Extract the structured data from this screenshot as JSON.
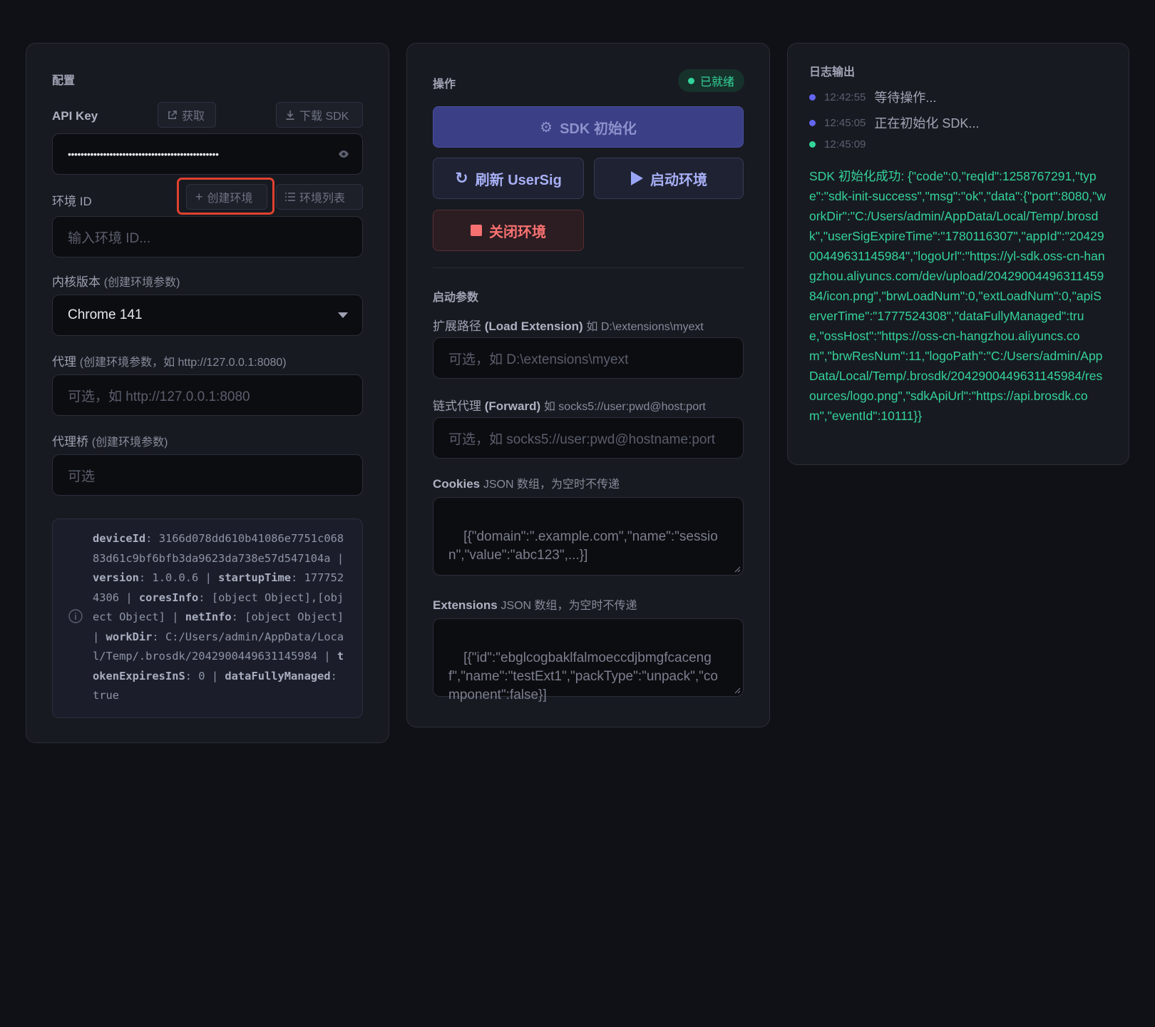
{
  "config": {
    "title": "配置",
    "api_key_label": "API Key",
    "get_button": "获取",
    "download_sdk_button": "下载 SDK",
    "api_key_value": "•••••••••••••••••••••••••••••••••••••••••••••••",
    "env_id_label": "环境 ID",
    "create_env_button": "创建环境",
    "env_list_button": "环境列表",
    "env_id_placeholder": "输入环境 ID...",
    "kernel_label": "内核版本",
    "kernel_note": "(创建环境参数)",
    "kernel_value": "Chrome 141",
    "proxy_label": "代理",
    "proxy_note": "(创建环境参数，如 http://127.0.0.1:8080)",
    "proxy_placeholder": "可选，如 http://127.0.0.1:8080",
    "bridge_label": "代理桥",
    "bridge_note": "(创建环境参数)",
    "bridge_placeholder": "可选",
    "info": {
      "deviceId_key": "deviceId",
      "deviceId": "3166d078dd610b41086e7751c06883d61c9bf6bfb3da9623da738e57d547104a",
      "version_key": "version",
      "version": "1.0.0.6",
      "startupTime_key": "startupTime",
      "startupTime": "1777524306",
      "coresInfo_key": "coresInfo",
      "coresInfo": "[object Object],[object Object]",
      "netInfo_key": "netInfo",
      "netInfo": "[object Object]",
      "workDir_key": "workDir",
      "workDir": "C:/Users/admin/AppData/Local/Temp/.brosdk/2042900449631145984",
      "tokenExpiresInS_key": "tokenExpiresInS",
      "tokenExpiresInS": "0",
      "dataFullyManaged_key": "dataFullyManaged",
      "dataFullyManaged": "true"
    }
  },
  "ops": {
    "title": "操作",
    "status_badge": "已就绪",
    "sdk_init_button": "SDK 初始化",
    "refresh_usersig_button": "刷新 UserSig",
    "start_env_button": "启动环境",
    "close_env_button": "关闭环境",
    "launch_params_title": "启动参数",
    "ext_path_label_a": "扩展路径",
    "ext_path_label_b": "(Load Extension)",
    "ext_path_label_c": "如 D:\\extensions\\myext",
    "ext_path_placeholder": "可选，如 D:\\extensions\\myext",
    "chain_proxy_label_a": "链式代理",
    "chain_proxy_label_b": "(Forward)",
    "chain_proxy_label_c": "如 socks5://user:pwd@host:port",
    "chain_proxy_placeholder": "可选，如 socks5://user:pwd@hostname:port",
    "cookies_label_a": "Cookies",
    "cookies_label_b": "JSON 数组，为空时不传递",
    "cookies_placeholder": "[{\"domain\":\".example.com\",\"name\":\"session\",\"value\":\"abc123\",...}]",
    "extensions_label_a": "Extensions",
    "extensions_label_b": "JSON 数组，为空时不传递",
    "extensions_placeholder": "[{\"id\":\"ebglcogbaklfalmoeccdjbmgfcacengf\",\"name\":\"testExt1\",\"packType\":\"unpack\",\"component\":false}]"
  },
  "log": {
    "title": "日志输出",
    "entries": [
      {
        "time": "12:42:55",
        "message": "等待操作..."
      },
      {
        "time": "12:45:05",
        "message": "正在初始化 SDK..."
      },
      {
        "time": "12:45:09",
        "message": ""
      }
    ],
    "success_text": "SDK 初始化成功: {\"code\":0,\"reqId\":1258767291,\"type\":\"sdk-init-success\",\"msg\":\"ok\",\"data\":{\"port\":8080,\"workDir\":\"C:/Users/admin/AppData/Local/Temp/.brosdk\",\"userSigExpireTime\":\"1780116307\",\"appId\":\"2042900449631145984\",\"logoUrl\":\"https://yl-sdk.oss-cn-hangzhou.aliyuncs.com/dev/upload/2042900449631145984/icon.png\",\"brwLoadNum\":0,\"extLoadNum\":0,\"apiServerTime\":\"1777524308\",\"dataFullyManaged\":true,\"ossHost\":\"https://oss-cn-hangzhou.aliyuncs.com\",\"brwResNum\":11,\"logoPath\":\"C:/Users/admin/AppData/Local/Temp/.brosdk/2042900449631145984/resources/logo.png\",\"sdkApiUrl\":\"https://api.brosdk.com\",\"eventId\":10111}}"
  },
  "colors": {
    "accent": "#5b62d6",
    "success": "#34d399",
    "danger": "#f87171",
    "highlight_border": "#e0412f"
  }
}
